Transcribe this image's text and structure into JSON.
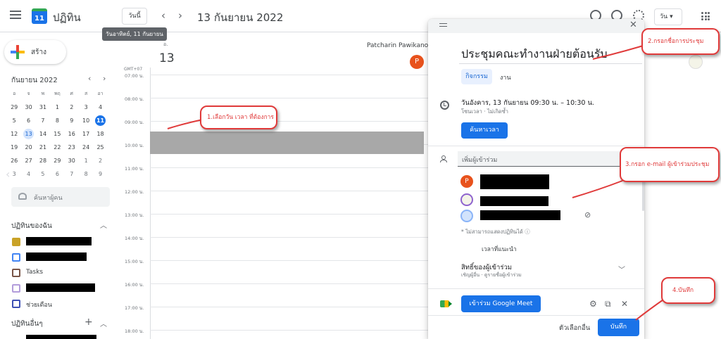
{
  "header": {
    "app_name": "ปฏิทิน",
    "logo_text": "11",
    "today_button": "วันนี้",
    "tooltip": "วันอาทิตย์, 11 กันยายน",
    "prev": "‹",
    "next": "›",
    "date_title": "13 กันยายน 2022",
    "view_button": "วัน ▾"
  },
  "sidebar": {
    "create_label": "สร้าง",
    "mini_calendar": {
      "title": "กันยายน 2022",
      "weekdays": [
        "อ",
        "จ",
        "พ",
        "พฤ",
        "ศ",
        "ส",
        "อา"
      ],
      "weeks": [
        [
          "29",
          "30",
          "31",
          "1",
          "2",
          "3",
          "4"
        ],
        [
          "5",
          "6",
          "7",
          "8",
          "9",
          "10",
          "11"
        ],
        [
          "12",
          "13",
          "14",
          "15",
          "16",
          "17",
          "18"
        ],
        [
          "19",
          "20",
          "21",
          "22",
          "23",
          "24",
          "25"
        ],
        [
          "26",
          "27",
          "28",
          "29",
          "30",
          "1",
          "2"
        ],
        [
          "3",
          "4",
          "5",
          "6",
          "7",
          "8",
          "9"
        ]
      ]
    },
    "search_people": "ค้นหาผู้คน",
    "my_calendars_title": "ปฏิทินของฉัน",
    "my_calendars": [
      {
        "label": "",
        "color": "#c9a227",
        "checked": true
      },
      {
        "label": "",
        "color": "#4285f4",
        "checked": false
      },
      {
        "label": "Tasks",
        "color": "#795548",
        "checked": false
      },
      {
        "label": "",
        "color": "#b39ddb",
        "checked": false
      },
      {
        "label": "ช่วยเตือน",
        "color": "#3f51b5",
        "checked": false
      }
    ],
    "other_calendars_title": "ปฏิทินอื่นๆ"
  },
  "main": {
    "day_label": "อ.",
    "day_number": "13",
    "owner_name": "Patcharin Pawikanon",
    "owner_initial": "P",
    "timezone": "GMT+07",
    "hours": [
      "07:00 น.",
      "08:00 น.",
      "09:00 น.",
      "10:00 น.",
      "11:00 น.",
      "12:00 น.",
      "13:00 น.",
      "14:00 น.",
      "15:00 น.",
      "16:00 น.",
      "17:00 น.",
      "18:00 น."
    ]
  },
  "dialog": {
    "close": "✕",
    "event_title": "ประชุมคณะทำงานฝ่ายต้อนรับ",
    "tabs": [
      "กิจกรรม",
      "งาน"
    ],
    "date_time": "วันอังคาร, 13 กันยายน    09:30 น.  –  10:30 น.",
    "timezone_note": "โซนเวลา · ไม่เกิดซ้ำ",
    "find_time_button": "ค้นหาเวลา",
    "add_guests_placeholder": "เพิ่มผู้เข้าร่วม",
    "guest_initial": "P",
    "guest_note": "* ไม่สามารถแสดงปฏิทินได้  ⓘ",
    "suggested_times": "เวลาที่แนะนำ",
    "permissions_title": "สิทธิ์ของผู้เข้าร่วม",
    "permissions_sub": "เชิญผู้อื่น · ดูรายชื่อผู้เข้าร่วม",
    "meet_button": "เข้าร่วม Google Meet",
    "more_options": "ตัวเลือกอื่น",
    "save_button": "บันทึก"
  },
  "annotations": {
    "step1": "1.เลือกวัน เวลา ที่ต้องการ",
    "step2": "2.กรอกชื่อการประชุม",
    "step3": "3.กรอก e-mail ผู้เข้าร่วมประชุม",
    "step4": "4.บันทึก",
    "color": "#e03a3a"
  }
}
